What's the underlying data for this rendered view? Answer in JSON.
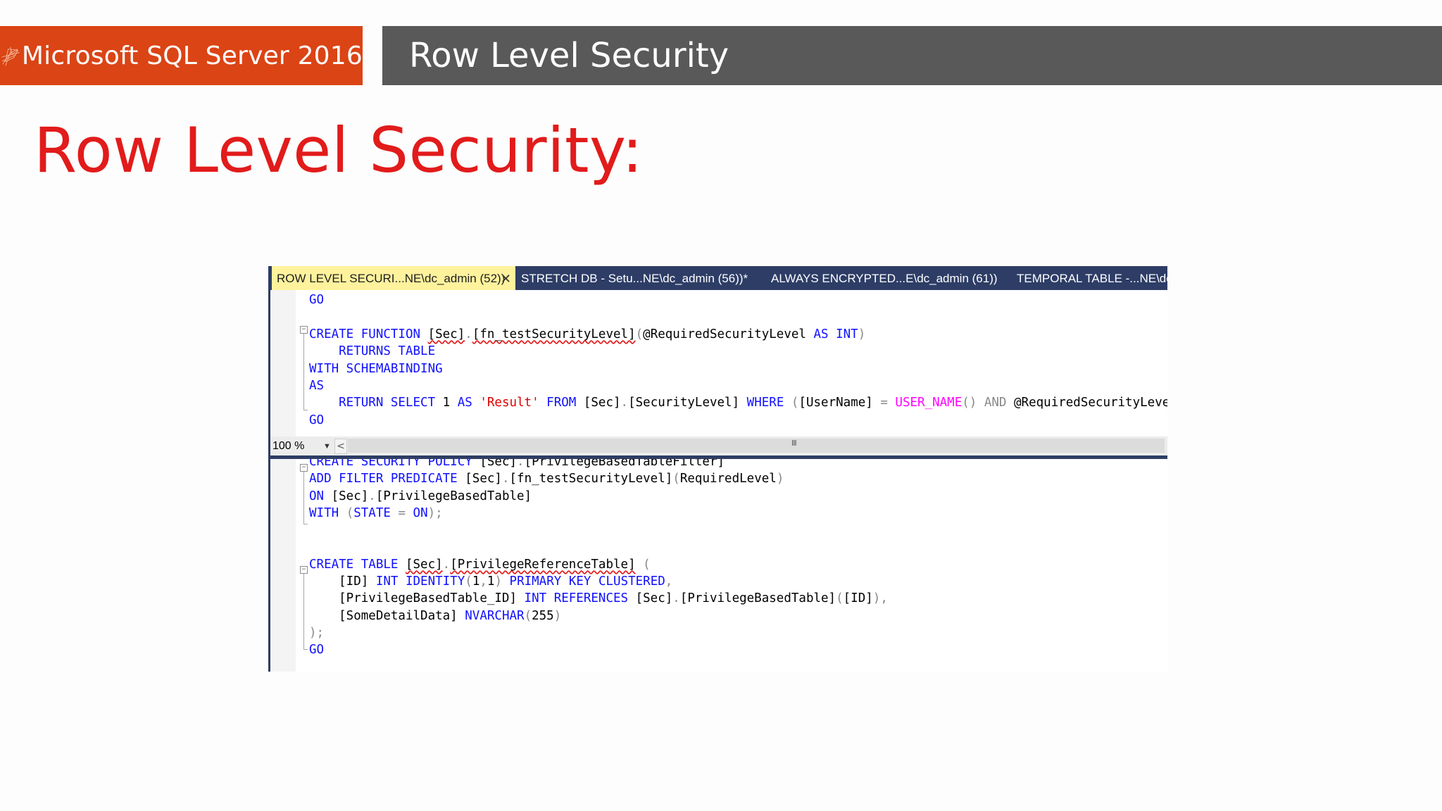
{
  "header": {
    "brand_label": "Microsoft SQL Server 2016",
    "brand_color": "#db4415",
    "bar_title": "Row Level Security",
    "bar_color": "#595959"
  },
  "slide": {
    "heading": "Row Level Security:",
    "heading_color": "#e21b1b"
  },
  "ssms": {
    "tabs": [
      {
        "label": "ROW LEVEL SECURI...NE\\dc_admin (52))",
        "active": true,
        "close": "✕"
      },
      {
        "label": "STRETCH DB - Setu...NE\\dc_admin (56))*",
        "active": false
      },
      {
        "label": "ALWAYS ENCRYPTED...E\\dc_admin (61))",
        "active": false
      },
      {
        "label": "TEMPORAL TABLE -...NE\\dc_",
        "active": false
      }
    ],
    "zoom": "100 %",
    "scroll_left": "<",
    "scroll_grip": "III",
    "top_pane": [
      [
        {
          "t": "GO",
          "c": "kw"
        }
      ],
      [],
      [
        {
          "t": "CREATE FUNCTION ",
          "c": "kw"
        },
        {
          "t": "[Sec]",
          "c": "sq"
        },
        {
          "t": ".",
          "c": "gr"
        },
        {
          "t": "[fn_testSecurityLevel]",
          "c": "sq"
        },
        {
          "t": "(",
          "c": "gr"
        },
        {
          "t": "@RequiredSecurityLevel ",
          "c": ""
        },
        {
          "t": "AS INT",
          "c": "kw"
        },
        {
          "t": ")",
          "c": "gr"
        }
      ],
      [
        {
          "t": "    RETURNS TABLE",
          "c": "kw"
        }
      ],
      [
        {
          "t": "WITH SCHEMABINDING",
          "c": "kw"
        }
      ],
      [
        {
          "t": "AS",
          "c": "kw"
        }
      ],
      [
        {
          "t": "    RETURN SELECT ",
          "c": "kw"
        },
        {
          "t": "1 ",
          "c": ""
        },
        {
          "t": "AS ",
          "c": "kw"
        },
        {
          "t": "'Result'",
          "c": "str"
        },
        {
          "t": " FROM ",
          "c": "kw"
        },
        {
          "t": "[Sec]",
          "c": ""
        },
        {
          "t": ".",
          "c": "gr"
        },
        {
          "t": "[SecurityLevel] ",
          "c": ""
        },
        {
          "t": "WHERE ",
          "c": "kw"
        },
        {
          "t": "(",
          "c": "gr"
        },
        {
          "t": "[UserName] ",
          "c": ""
        },
        {
          "t": "= ",
          "c": "gr"
        },
        {
          "t": "USER_NAME",
          "c": "fn"
        },
        {
          "t": "() ",
          "c": "gr"
        },
        {
          "t": "AND ",
          "c": "gr"
        },
        {
          "t": "@RequiredSecurityLevel",
          "c": ""
        }
      ],
      [
        {
          "t": "GO",
          "c": "kw"
        }
      ]
    ],
    "bottom_pane": [
      [
        {
          "t": "CREATE SECURITY POLICY ",
          "c": "kw"
        },
        {
          "t": "[Sec]",
          "c": ""
        },
        {
          "t": ".",
          "c": "gr"
        },
        {
          "t": "[PrivilegeBasedTableFilter]",
          "c": ""
        }
      ],
      [
        {
          "t": "ADD FILTER PREDICATE ",
          "c": "kw"
        },
        {
          "t": "[Sec]",
          "c": ""
        },
        {
          "t": ".",
          "c": "gr"
        },
        {
          "t": "[fn_testSecurityLevel]",
          "c": ""
        },
        {
          "t": "(",
          "c": "gr"
        },
        {
          "t": "RequiredLevel",
          "c": ""
        },
        {
          "t": ")",
          "c": "gr"
        }
      ],
      [
        {
          "t": "ON ",
          "c": "kw"
        },
        {
          "t": "[Sec]",
          "c": ""
        },
        {
          "t": ".",
          "c": "gr"
        },
        {
          "t": "[PrivilegeBasedTable]",
          "c": ""
        }
      ],
      [
        {
          "t": "WITH ",
          "c": "kw"
        },
        {
          "t": "(",
          "c": "gr"
        },
        {
          "t": "STATE ",
          "c": "kw"
        },
        {
          "t": "= ",
          "c": "gr"
        },
        {
          "t": "ON",
          "c": "kw"
        },
        {
          "t": ");",
          "c": "gr"
        }
      ],
      [],
      [],
      [
        {
          "t": "CREATE TABLE ",
          "c": "kw"
        },
        {
          "t": "[Sec]",
          "c": "sq"
        },
        {
          "t": ".",
          "c": "gr"
        },
        {
          "t": "[PrivilegeReferenceTable]",
          "c": "sq"
        },
        {
          "t": " (",
          "c": "gr"
        }
      ],
      [
        {
          "t": "    [ID] ",
          "c": ""
        },
        {
          "t": "INT IDENTITY",
          "c": "kw"
        },
        {
          "t": "(",
          "c": "gr"
        },
        {
          "t": "1",
          "c": ""
        },
        {
          "t": ",",
          "c": "gr"
        },
        {
          "t": "1",
          "c": ""
        },
        {
          "t": ") ",
          "c": "gr"
        },
        {
          "t": "PRIMARY KEY CLUSTERED",
          "c": "kw"
        },
        {
          "t": ",",
          "c": "gr"
        }
      ],
      [
        {
          "t": "    [PrivilegeBasedTable_ID] ",
          "c": ""
        },
        {
          "t": "INT REFERENCES ",
          "c": "kw"
        },
        {
          "t": "[Sec]",
          "c": ""
        },
        {
          "t": ".",
          "c": "gr"
        },
        {
          "t": "[PrivilegeBasedTable]",
          "c": ""
        },
        {
          "t": "(",
          "c": "gr"
        },
        {
          "t": "[ID]",
          "c": ""
        },
        {
          "t": "),",
          "c": "gr"
        }
      ],
      [
        {
          "t": "    [SomeDetailData] ",
          "c": ""
        },
        {
          "t": "NVARCHAR",
          "c": "kw"
        },
        {
          "t": "(",
          "c": "gr"
        },
        {
          "t": "255",
          "c": ""
        },
        {
          "t": ")",
          "c": "gr"
        }
      ],
      [
        {
          "t": ");",
          "c": "gr"
        }
      ],
      [
        {
          "t": "GO",
          "c": "kw"
        }
      ]
    ]
  }
}
